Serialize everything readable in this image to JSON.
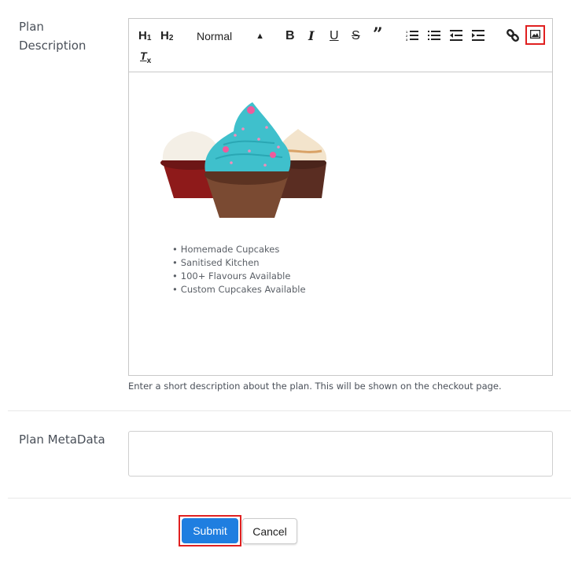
{
  "description_field": {
    "label_line1": "Plan",
    "label_line2": "Description",
    "toolbar": {
      "h1": "H",
      "h1_sub": "1",
      "h2": "H",
      "h2_sub": "2",
      "format_select": "Normal",
      "format_arrow": "↕",
      "bold": "B",
      "italic": "I",
      "underline": "U",
      "strike": "S",
      "quote": "”",
      "clean": "T",
      "clean_sub": "x",
      "icons": [
        "heading-1-icon",
        "heading-2-icon",
        "bold-icon",
        "italic-icon",
        "underline-icon",
        "strikethrough-icon",
        "blockquote-icon",
        "ordered-list-icon",
        "bullet-list-icon",
        "outdent-icon",
        "indent-icon",
        "link-icon",
        "image-icon",
        "clear-formatting-icon"
      ]
    },
    "content": {
      "image_alt": "Three cupcakes: red velvet, blue frosted chocolate, caramel",
      "features": [
        "Homemade Cupcakes",
        "Sanitised Kitchen",
        "100+ Flavours Available",
        "Custom Cupcakes Available"
      ]
    },
    "help_text": "Enter a short description about the plan. This will be shown on the checkout page."
  },
  "metadata_field": {
    "label": "Plan MetaData",
    "value": ""
  },
  "actions": {
    "submit_label": "Submit",
    "cancel_label": "Cancel"
  },
  "colors": {
    "primary": "#1f7ee0",
    "highlight": "#e02020"
  }
}
